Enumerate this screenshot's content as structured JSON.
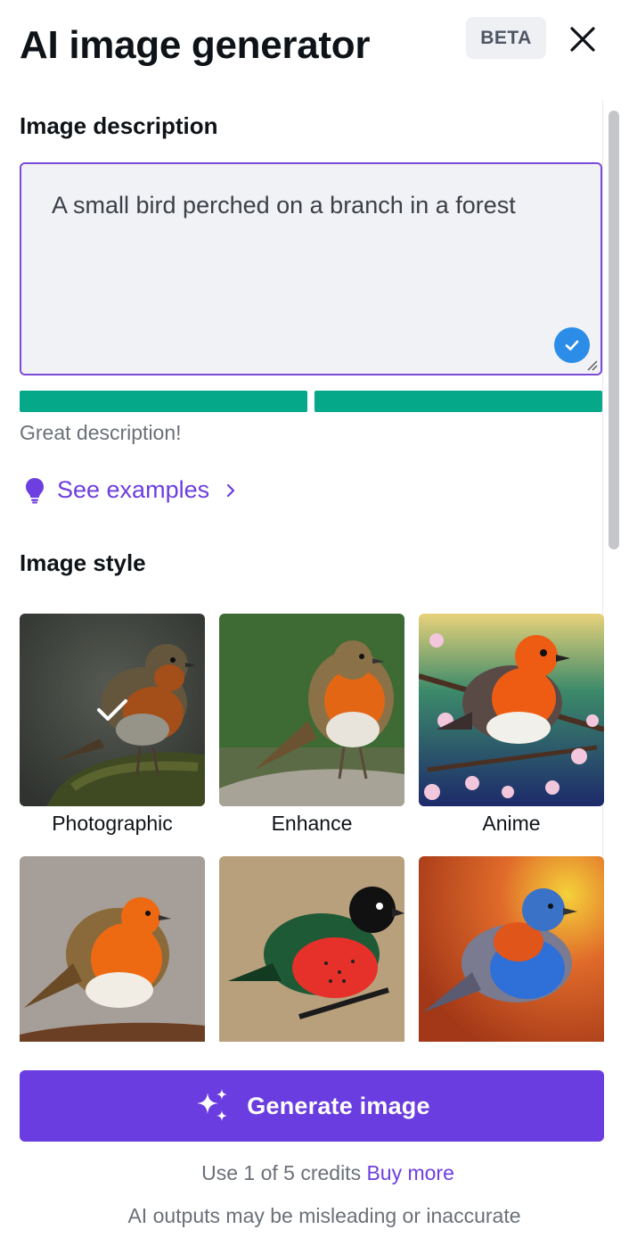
{
  "header": {
    "title": "AI image generator",
    "badge": "BETA",
    "close_icon": "close-icon"
  },
  "description": {
    "heading": "Image description",
    "value": "A small bird perched on a branch in a forest",
    "valid_icon": "check-circle-icon",
    "quality_segments_filled": 2,
    "quality_segments_total": 2,
    "quality_color": "#06a88a",
    "feedback": "Great description!"
  },
  "examples": {
    "icon": "lightbulb-icon",
    "label": "See examples",
    "chevron_icon": "chevron-right-icon"
  },
  "style": {
    "heading": "Image style",
    "options": [
      {
        "label": "Photographic",
        "selected": true
      },
      {
        "label": "Enhance",
        "selected": false
      },
      {
        "label": "Anime",
        "selected": false
      },
      {
        "label": "",
        "selected": false
      },
      {
        "label": "",
        "selected": false
      },
      {
        "label": "",
        "selected": false
      }
    ]
  },
  "footer": {
    "generate_label": "Generate image",
    "generate_icon": "sparkles-icon",
    "credits_text": "Use 1 of 5 credits",
    "buy_more": "Buy more",
    "disclaimer": "AI outputs may be misleading or inaccurate"
  },
  "colors": {
    "accent": "#6a3de0",
    "link": "#6d3ee0",
    "textarea_border": "#7d4ad8",
    "success": "#06a88a",
    "check_badge": "#2b8de7"
  }
}
